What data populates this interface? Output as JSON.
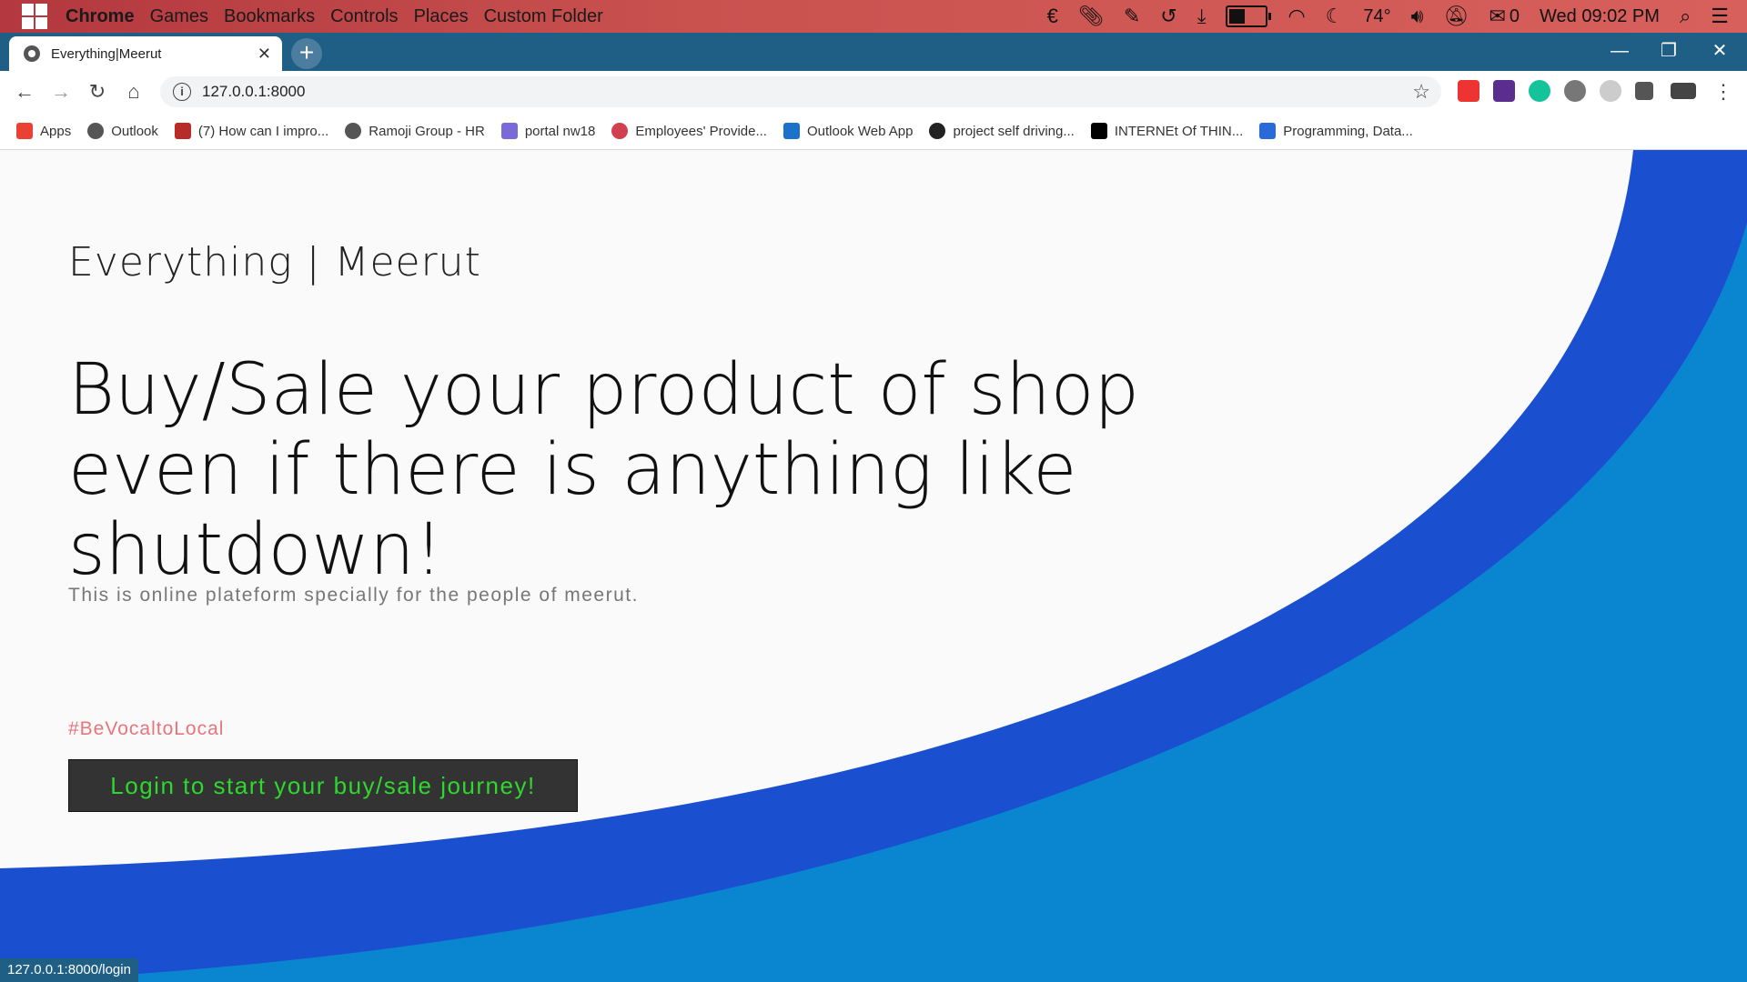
{
  "os_bar": {
    "menu": [
      "Chrome",
      "Games",
      "Bookmarks",
      "Controls",
      "Places",
      "Custom Folder"
    ],
    "temperature": "74°",
    "mail_count": "0",
    "clock": "Wed 09:02 PM",
    "battery_level": 0.45,
    "icons": [
      "euro-icon",
      "paperclip-icon",
      "pencil-icon",
      "history-icon",
      "download-icon",
      "battery-icon",
      "wifi-icon",
      "weather-icon",
      "volume-icon",
      "mute-bell-icon",
      "mail-icon",
      "search-icon",
      "list-icon"
    ]
  },
  "browser": {
    "tab_title": "Everything|Meerut",
    "url": "127.0.0.1:8000",
    "status_url": "127.0.0.1:8000/login"
  },
  "bookmarks": [
    {
      "label": "Apps",
      "icon": "apps-grid-icon",
      "color": "#e94235"
    },
    {
      "label": "Outlook",
      "icon": "globe-icon",
      "color": "#555555"
    },
    {
      "label": "(7) How can I impro...",
      "icon": "quora-icon",
      "color": "#b92b27"
    },
    {
      "label": "Ramoji Group - HR",
      "icon": "globe-icon",
      "color": "#555555"
    },
    {
      "label": "portal nw18",
      "icon": "portal-icon",
      "color": "#7a6ad8"
    },
    {
      "label": "Employees' Provide...",
      "icon": "epfo-icon",
      "color": "#d04050"
    },
    {
      "label": "Outlook Web App",
      "icon": "outlook-icon",
      "color": "#1a73c8"
    },
    {
      "label": "project self driving...",
      "icon": "github-icon",
      "color": "#222222"
    },
    {
      "label": "INTERNEt Of THIN...",
      "icon": "medium-icon",
      "color": "#000000"
    },
    {
      "label": "Programming, Data...",
      "icon": "s-icon",
      "color": "#2a6ad8"
    }
  ],
  "page": {
    "brand": "Everything | Meerut",
    "headline": "Buy/Sale your product of shop even if there is anything like shutdown!",
    "tagline": "This is online plateform specially for the people of meerut.",
    "hashtag": "#BeVocaltoLocal",
    "cta_label": "Login to start your buy/sale journey!"
  },
  "colors": {
    "wave_dark": "#1a4fd0",
    "wave_light": "#0a86d0",
    "cta_text": "#2ed82e",
    "hashtag": "#e8747c"
  }
}
